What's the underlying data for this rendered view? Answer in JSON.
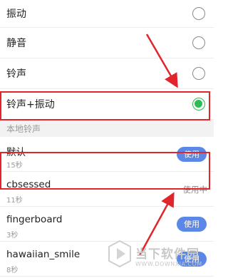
{
  "ring_modes": [
    {
      "label": "振动",
      "selected": false
    },
    {
      "label": "静音",
      "selected": false
    },
    {
      "label": "铃声",
      "selected": false
    },
    {
      "label": "铃声+振动",
      "selected": true
    }
  ],
  "local_ringtones": {
    "header": "本地铃声",
    "items": [
      {
        "name": "默认",
        "duration": "15秒",
        "action": "使用",
        "in_use": false
      },
      {
        "name": "cbsessed",
        "duration": "11秒",
        "action": "使用中",
        "in_use": true
      },
      {
        "name": "fingerboard",
        "duration": "3秒",
        "action": "使用",
        "in_use": false
      },
      {
        "name": "hawaiian_smile",
        "duration": "8秒",
        "action": "使用",
        "in_use": false
      }
    ]
  },
  "watermark": {
    "title": "当下软件园",
    "url": "WWW.DOWNXIA.COM"
  },
  "colors": {
    "highlight": "#e0262c",
    "radio_selected": "#2ebc54",
    "use_button": "#5b87e6",
    "section_header_bg": "#f2f2f2"
  }
}
